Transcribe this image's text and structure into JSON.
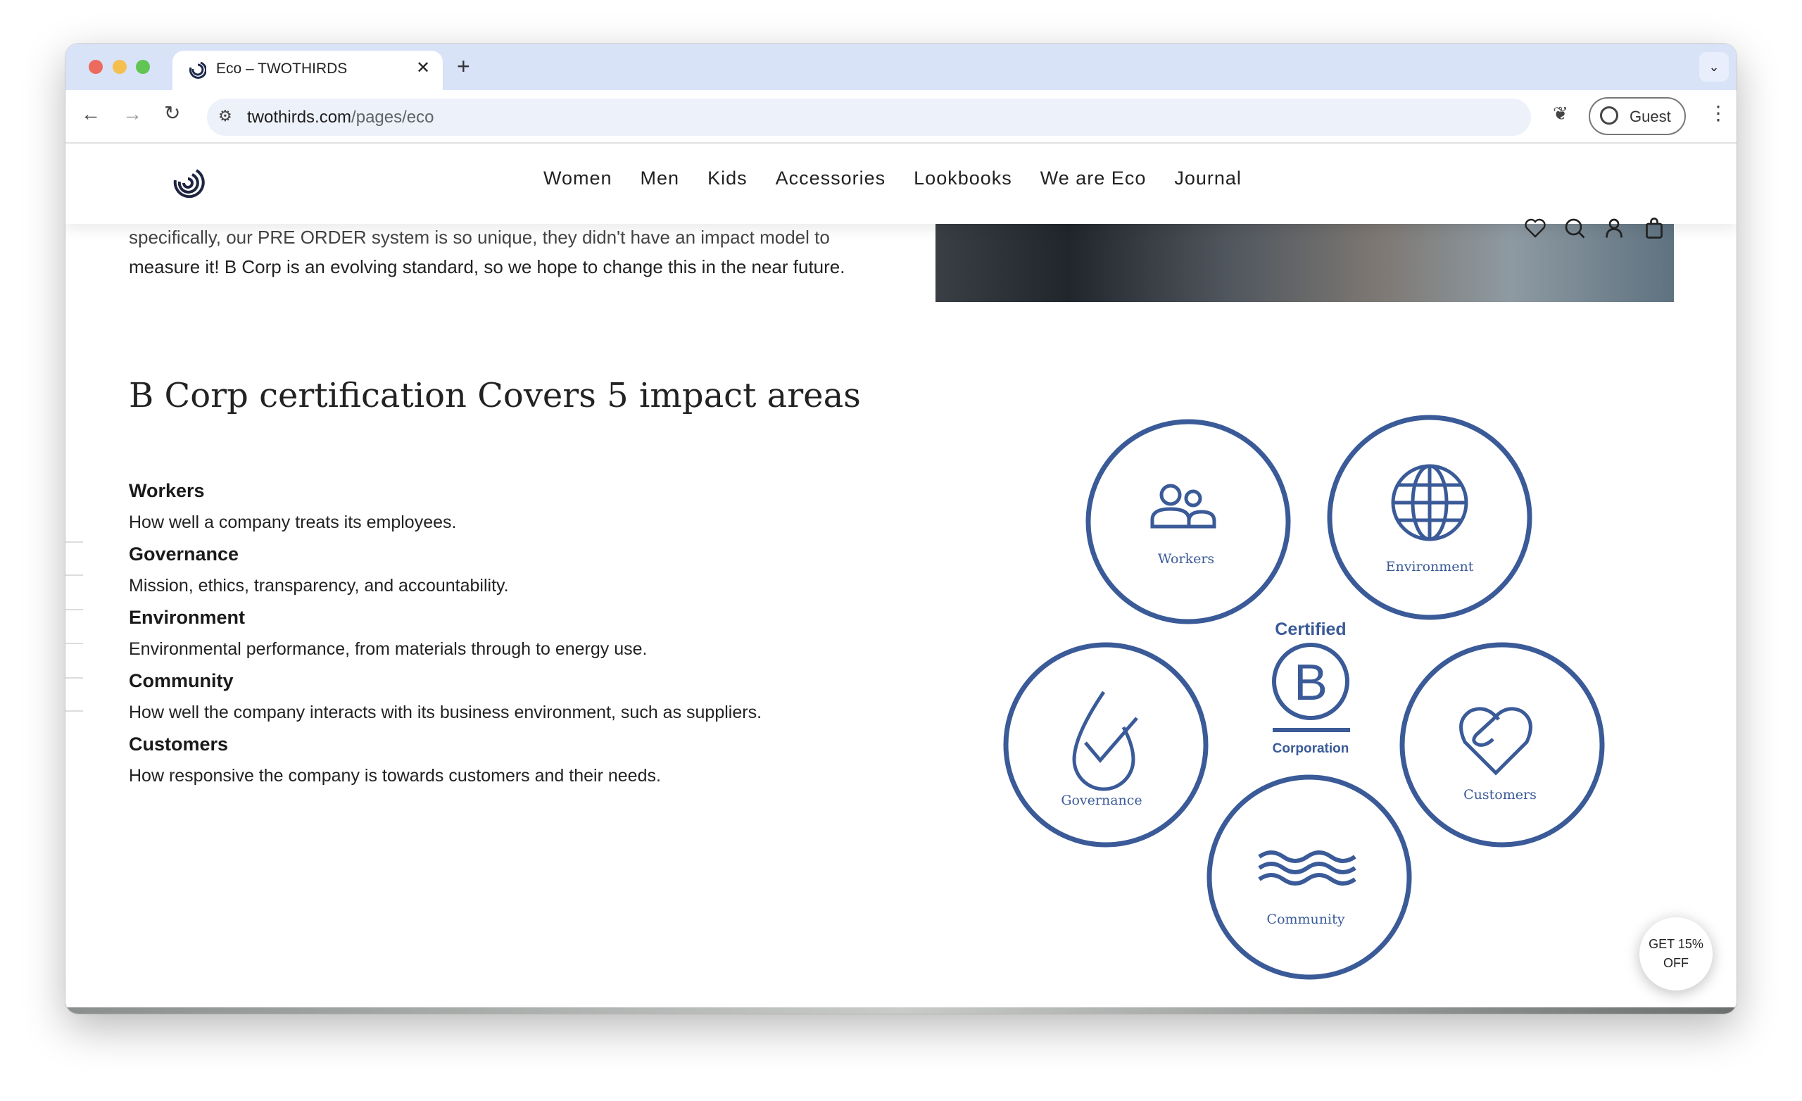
{
  "browser": {
    "tab_title": "Eco – TWOTHIRDS",
    "url_host": "twothirds.com",
    "url_path": "/pages/eco",
    "profile_label": "Guest"
  },
  "site": {
    "nav": [
      "Women",
      "Men",
      "Kids",
      "Accessories",
      "Lookbooks",
      "We are Eco",
      "Journal"
    ]
  },
  "content": {
    "intro_line_partial": "specifically, our PRE ORDER system is so unique, they didn't have an impact model to",
    "intro_line": "measure it! B Corp is an evolving standard, so we hope to change this in the near future.",
    "heading": "B Corp certification Covers 5 impact areas",
    "areas": [
      {
        "term": "Workers",
        "desc": "How well a company treats its employees."
      },
      {
        "term": "Governance",
        "desc": "Mission, ethics, transparency, and accountability."
      },
      {
        "term": "Environment",
        "desc": "Environmental performance, from materials through to energy use."
      },
      {
        "term": "Community",
        "desc": "How well the company interacts with its business environment, such as suppliers."
      },
      {
        "term": "Customers",
        "desc": "How responsive the company is towards customers and their needs."
      }
    ]
  },
  "graphic": {
    "color": "#3a5a98",
    "certified": "Certified",
    "corporation": "Corporation",
    "labels": {
      "workers": "Workers",
      "environment": "Environment",
      "governance": "Governance",
      "customers": "Customers",
      "community": "Community"
    }
  },
  "promo": {
    "line1": "GET 15%",
    "line2": "OFF"
  }
}
